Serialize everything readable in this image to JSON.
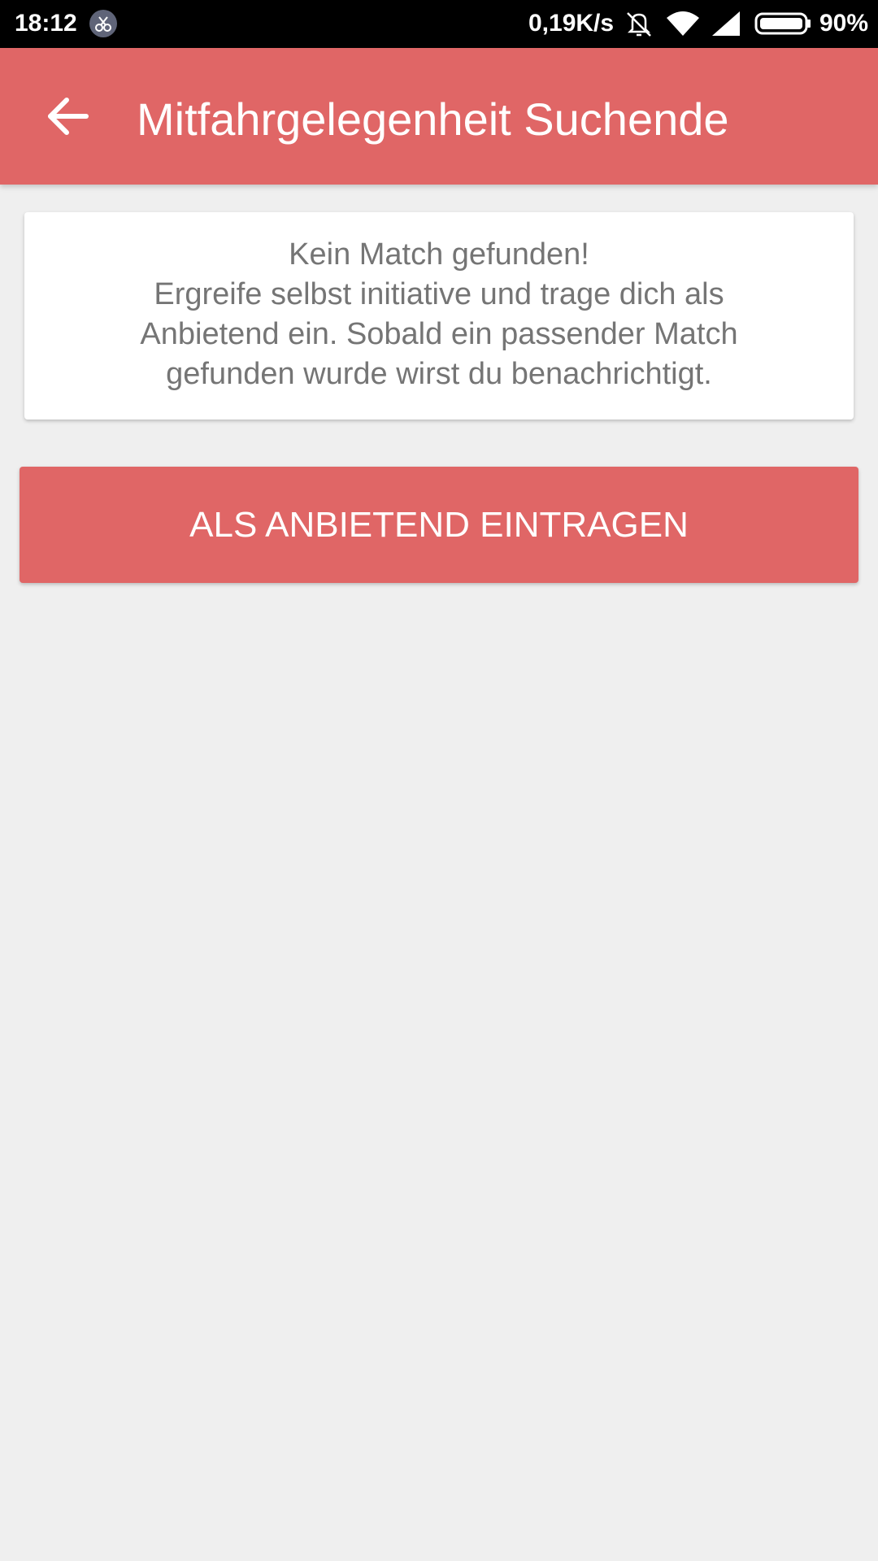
{
  "status_bar": {
    "time": "18:12",
    "app_icon": "scissors-icon",
    "network_speed": "0,19K/s",
    "icons": [
      "vibrate-icon",
      "wifi-icon",
      "signal-icon",
      "battery-icon"
    ],
    "battery_percent": "90%"
  },
  "app_bar": {
    "back_icon": "arrow-left-icon",
    "title": "Mitfahrgelegenheit Suchende",
    "color": "#e06666"
  },
  "card": {
    "lines": [
      "Kein Match gefunden!",
      "Ergreife selbst initiative und trage dich als",
      "Anbietend ein. Sobald ein passender Match",
      "gefunden wurde wirst du benachrichtigt."
    ]
  },
  "button": {
    "label": "ALS ANBIETEND EINTRAGEN",
    "color": "#e06666"
  },
  "colors": {
    "accent": "#e06666",
    "background": "#efefef",
    "text_secondary": "#757575"
  }
}
